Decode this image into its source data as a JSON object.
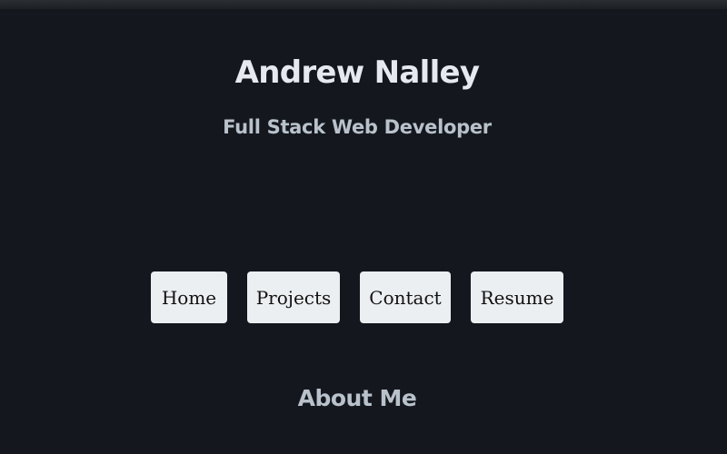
{
  "header": {
    "name": "Andrew Nalley",
    "subtitle": "Full Stack Web Developer"
  },
  "nav": {
    "items": [
      {
        "label": "Home"
      },
      {
        "label": "Projects"
      },
      {
        "label": "Contact"
      },
      {
        "label": "Resume"
      }
    ]
  },
  "sections": {
    "about_heading": "About Me"
  },
  "colors": {
    "background": "#14181e",
    "name_text": "#e6e9ef",
    "subtitle_text": "#b9c2cb",
    "button_bg": "#eceff2",
    "button_text": "#111111"
  }
}
